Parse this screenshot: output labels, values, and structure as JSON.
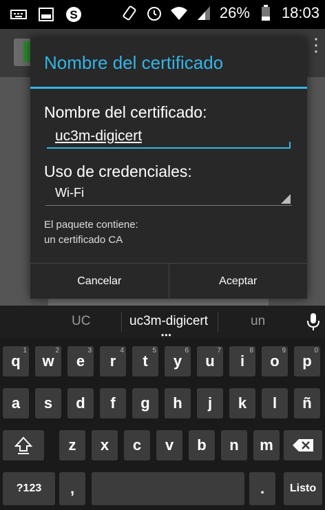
{
  "status_bar": {
    "battery_percent": "26%",
    "time": "18:03",
    "icons": [
      "keyboard-icon",
      "screenshot-icon",
      "app-s-icon",
      "rotate-icon",
      "alarm-icon",
      "wifi-icon",
      "signal-icon",
      "battery-icon"
    ]
  },
  "dialog": {
    "title": "Nombre del certificado",
    "name_label": "Nombre del certificado:",
    "name_value": "uc3m-digicert",
    "usage_label": "Uso de credenciales:",
    "usage_selected": "Wi-Fi",
    "info_line1": "El paquete contiene:",
    "info_line2": "un certificado CA",
    "cancel_label": "Cancelar",
    "accept_label": "Aceptar",
    "accent_color": "#33b5e5"
  },
  "keyboard": {
    "suggestions": [
      "UC",
      "uc3m-digicert",
      "un"
    ],
    "row1": [
      {
        "key": "q",
        "hint": "1"
      },
      {
        "key": "w",
        "hint": "2"
      },
      {
        "key": "e",
        "hint": "3"
      },
      {
        "key": "r",
        "hint": "4"
      },
      {
        "key": "t",
        "hint": "5"
      },
      {
        "key": "y",
        "hint": "6"
      },
      {
        "key": "u",
        "hint": "7"
      },
      {
        "key": "i",
        "hint": "8"
      },
      {
        "key": "o",
        "hint": "9"
      },
      {
        "key": "p",
        "hint": "0"
      }
    ],
    "row2": [
      "a",
      "s",
      "d",
      "f",
      "g",
      "h",
      "j",
      "k",
      "l",
      "ñ"
    ],
    "row3": [
      "z",
      "x",
      "c",
      "v",
      "b",
      "n",
      "m"
    ],
    "symbols_label": "?123",
    "comma_label": ",",
    "period_label": ".",
    "done_label": "Listo"
  }
}
